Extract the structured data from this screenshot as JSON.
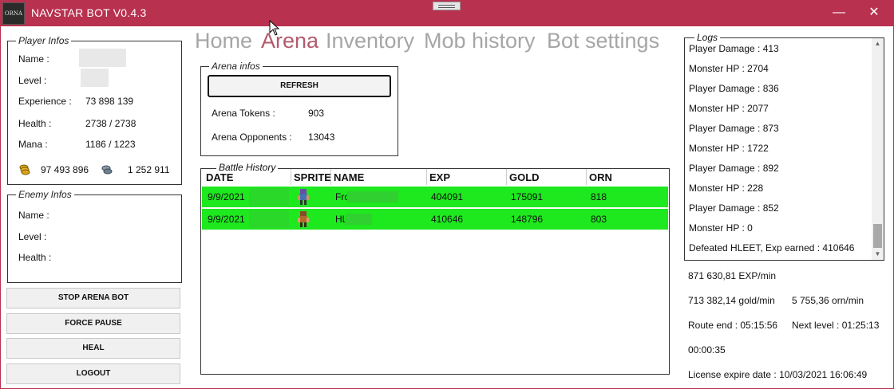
{
  "window": {
    "title": "NAVSTAR BOT V0.4.3",
    "logo_text": "ORNA"
  },
  "player": {
    "legend": "Player Infos",
    "name_label": "Name :",
    "level_label": "Level :",
    "experience_label": "Experience :",
    "experience": "73 898 139",
    "health_label": "Health :",
    "health": "2738 / 2738",
    "mana_label": "Mana :",
    "mana": "1186 / 1223",
    "gold": "97 493 896",
    "orn": "1 252 911"
  },
  "enemy": {
    "legend": "Enemy Infos",
    "name_label": "Name :",
    "level_label": "Level :",
    "health_label": "Health :"
  },
  "actions": {
    "stop_arena": "STOP ARENA BOT",
    "force_pause": "FORCE PAUSE",
    "heal": "HEAL",
    "logout": "LOGOUT"
  },
  "tabs": [
    "Home",
    "Arena",
    "Inventory",
    "Mob history",
    "Bot settings"
  ],
  "arena": {
    "legend": "Arena infos",
    "refresh": "REFRESH",
    "tokens_label": "Arena Tokens :",
    "tokens": "903",
    "opponents_label": "Arena Opponents :",
    "opponents": "13043"
  },
  "battle_history": {
    "legend": "Battle History",
    "columns": [
      "DATE",
      "SPRITE",
      "NAME",
      "EXP",
      "GOLD",
      "ORN"
    ],
    "rows": [
      {
        "date": "9/9/2021",
        "name": "Fro",
        "exp": "404091",
        "gold": "175091",
        "orn": "818"
      },
      {
        "date": "9/9/2021",
        "name": "HL",
        "exp": "410646",
        "gold": "148796",
        "orn": "803"
      }
    ],
    "row_color": "#1ee81e"
  },
  "logs": {
    "legend": "Logs",
    "lines": [
      "Player Damage : 413",
      "Monster HP : 2704",
      "Player Damage : 836",
      "Monster HP : 2077",
      "Player Damage : 873",
      "Monster HP : 1722",
      "Player Damage : 892",
      "Monster HP : 228",
      "Player Damage : 852",
      "Monster HP : 0",
      "Defeated HLEET, Exp earned : 410646"
    ]
  },
  "stats": {
    "exp_rate": "871 630,81 EXP/min",
    "gold_rate": "713 382,14 gold/min",
    "orn_rate": "5 755,36 orn/min",
    "route_end": "Route end : 05:15:56",
    "next_level": "Next level : 01:25:13",
    "elapsed": "00:00:35",
    "license": "License expire date : 10/03/2021 16:06:49"
  },
  "colors": {
    "titlebar": "#b8314f",
    "active_tab": "#b35a6c",
    "inactive_tab": "#a6a6a6"
  }
}
